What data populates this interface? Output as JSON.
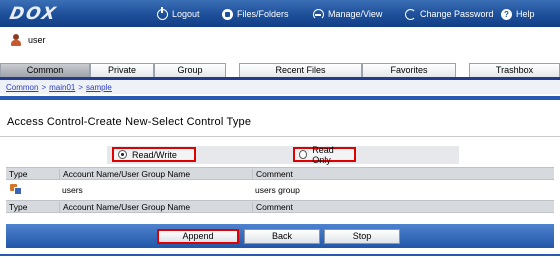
{
  "brand": {
    "logo": "DOX"
  },
  "nav": {
    "logout": "Logout",
    "files": "Files/Folders",
    "manage": "Manage/View",
    "password": "Change Password",
    "help": "Help"
  },
  "user": {
    "name": "user"
  },
  "tabs": [
    "Common",
    "Private",
    "Group",
    "Recent Files",
    "Favorites",
    "Trashbox"
  ],
  "active_tab": "Common",
  "breadcrumb": [
    "Common",
    "main01",
    "sample"
  ],
  "page_title": "Access Control-Create New-Select Control Type",
  "options": {
    "read_write": "Read/Write",
    "read_only": "Read Only",
    "selected": "Read/Write"
  },
  "table": {
    "headers": [
      "Type",
      "Account Name/User Group Name",
      "Comment"
    ],
    "rows": [
      {
        "type_icon": "group-icon",
        "name": "users",
        "comment": "users group"
      }
    ]
  },
  "buttons": {
    "append": "Append",
    "back": "Back",
    "stop": "Stop"
  },
  "colors": {
    "header_bar": "#1d4f9a",
    "highlight": "#e00000",
    "tab_line": "#243a8c"
  }
}
